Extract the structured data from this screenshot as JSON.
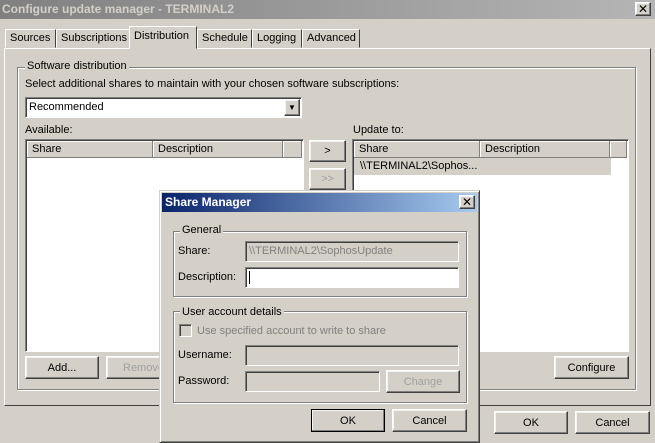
{
  "window": {
    "title": "Configure update manager - TERMINAL2",
    "tabs": [
      "Sources",
      "Subscriptions",
      "Distribution",
      "Schedule",
      "Logging",
      "Advanced"
    ],
    "active_tab": "Distribution",
    "software_distribution": {
      "group_label": "Software distribution",
      "instruction": "Select additional shares to maintain with your chosen software subscriptions:",
      "subscription_select": "Recommended",
      "available_label": "Available:",
      "update_to_label": "Update to:",
      "columns": [
        "Share",
        "Description"
      ],
      "update_to_rows": [
        {
          "share": "\\\\TERMINAL2\\Sophos...",
          "description": ""
        }
      ],
      "move_one_button": ">",
      "move_all_button": ">>",
      "add_button": "Add...",
      "remove_button": "Remove",
      "configure_button": "Configure"
    },
    "ok_button": "OK",
    "cancel_button": "Cancel"
  },
  "dialog": {
    "title": "Share Manager",
    "general_label": "General",
    "share_label": "Share:",
    "share_value": "\\\\TERMINAL2\\SophosUpdate",
    "description_label": "Description:",
    "description_value": "",
    "account_label": "User account details",
    "use_account_checkbox": "Use specified account to write to share",
    "username_label": "Username:",
    "password_label": "Password:",
    "change_button": "Change",
    "ok_button": "OK",
    "cancel_button": "Cancel"
  }
}
